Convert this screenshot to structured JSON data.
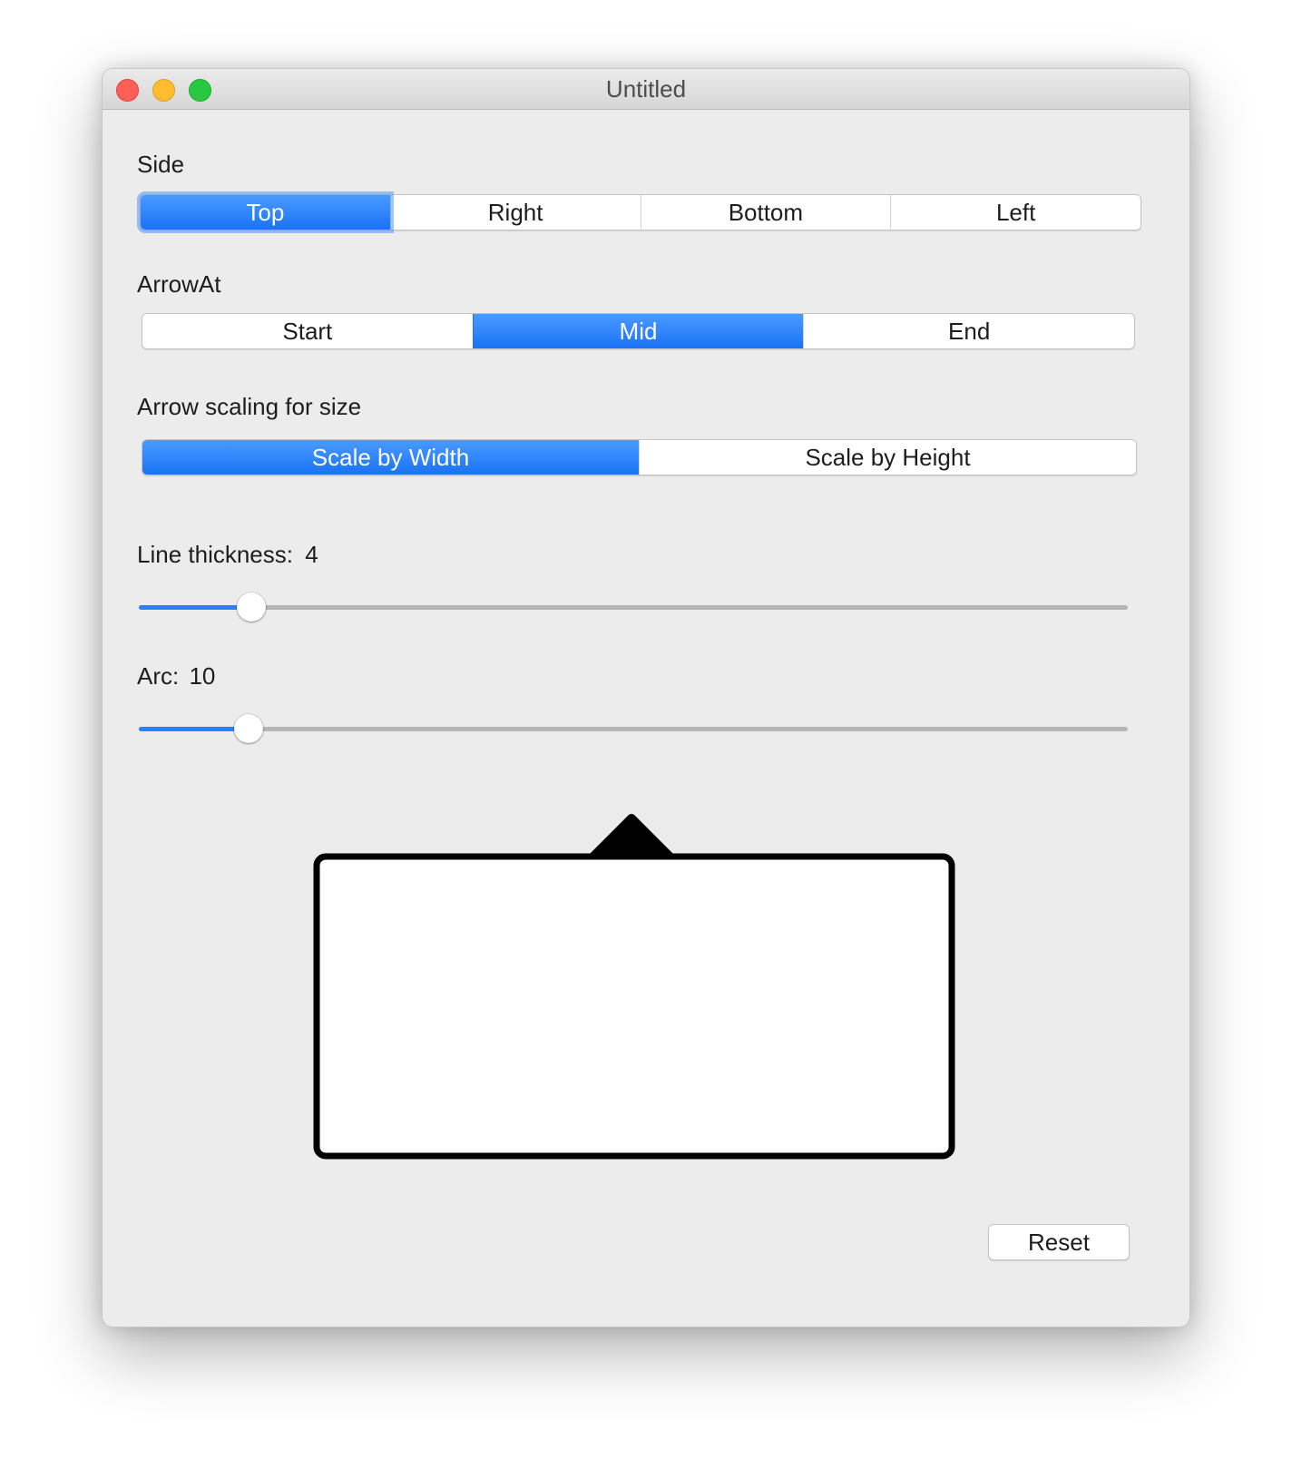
{
  "window": {
    "title": "Untitled"
  },
  "side": {
    "label": "Side",
    "options": [
      "Top",
      "Right",
      "Bottom",
      "Left"
    ],
    "selected": "Top"
  },
  "arrow_at": {
    "label": "ArrowAt",
    "options": [
      "Start",
      "Mid",
      "End"
    ],
    "selected": "Mid"
  },
  "arrow_scaling": {
    "label": "Arrow scaling for size",
    "options": [
      "Scale by Width",
      "Scale by Height"
    ],
    "selected": "Scale by Width"
  },
  "line_thickness": {
    "label": "Line thickness:",
    "value": "4",
    "slider_fraction": 0.114
  },
  "arc": {
    "label": "Arc:",
    "value": "10",
    "slider_fraction": 0.111
  },
  "reset_label": "Reset",
  "colors": {
    "accent": "#1a72f5",
    "preview_stroke": "#000000",
    "preview_fill": "#ffffff"
  }
}
